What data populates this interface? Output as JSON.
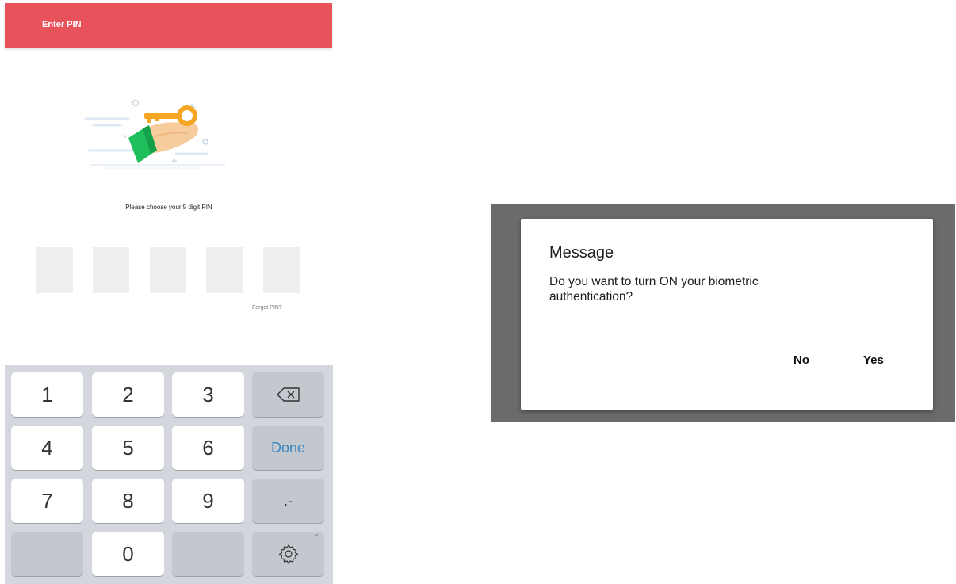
{
  "pin_screen": {
    "header": {
      "title": "Enter PIN",
      "color": "#e8525a"
    },
    "prompt": "Please choose your 5 digit PIN",
    "pin_boxes": [
      "",
      "",
      "",
      "",
      ""
    ],
    "forgot_link": "Forgot PIN?",
    "keyboard": {
      "rows": [
        [
          "1",
          "2",
          "3",
          "backspace-icon"
        ],
        [
          "4",
          "5",
          "6",
          "Done"
        ],
        [
          "7",
          "8",
          "9",
          ".-"
        ],
        [
          "",
          "0",
          "",
          "gear-icon"
        ]
      ],
      "done_label": "Done",
      "dash_label": ".-",
      "done_color": "#3a88c4"
    }
  },
  "dialog": {
    "title": "Message",
    "body": "Do you want to turn ON your biometric authentication?",
    "buttons": {
      "no": "No",
      "yes": "Yes"
    }
  }
}
